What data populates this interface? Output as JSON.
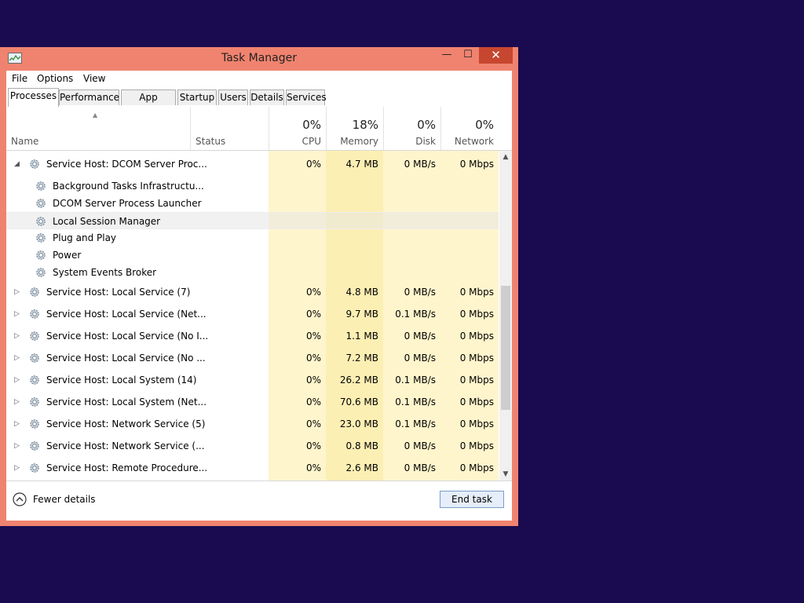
{
  "window": {
    "title": "Task Manager"
  },
  "titlebar": {
    "minimize": "—",
    "maximize": "☐",
    "close": "✕"
  },
  "menu": [
    "File",
    "Options",
    "View"
  ],
  "tabs": [
    "Processes",
    "Performance",
    "App history",
    "Startup",
    "Users",
    "Details",
    "Services"
  ],
  "active_tab": "Processes",
  "header": {
    "name": "Name",
    "status": "Status",
    "cpu": {
      "pct": "0%",
      "label": "CPU"
    },
    "memory": {
      "pct": "18%",
      "label": "Memory"
    },
    "disk": {
      "pct": "0%",
      "label": "Disk"
    },
    "network": {
      "pct": "0%",
      "label": "Network"
    }
  },
  "rows": [
    {
      "name": "Service Host: DCOM Server Proc...",
      "expander": "◢",
      "level": 0,
      "cpu": "0%",
      "memory": "4.7 MB",
      "disk": "0 MB/s",
      "network": "0 Mbps"
    },
    {
      "name": "Background Tasks Infrastructu...",
      "level": 1
    },
    {
      "name": "DCOM Server Process Launcher",
      "level": 1
    },
    {
      "name": "Local Session Manager",
      "level": 1,
      "highlight": true
    },
    {
      "name": "Plug and Play",
      "level": 1
    },
    {
      "name": "Power",
      "level": 1
    },
    {
      "name": "System Events Broker",
      "level": 1
    },
    {
      "name": "Service Host: Local Service (7)",
      "expander": "▷",
      "level": 0,
      "cpu": "0%",
      "memory": "4.8 MB",
      "disk": "0 MB/s",
      "network": "0 Mbps"
    },
    {
      "name": "Service Host: Local Service (Net...",
      "expander": "▷",
      "level": 0,
      "cpu": "0%",
      "memory": "9.7 MB",
      "disk": "0.1 MB/s",
      "network": "0 Mbps"
    },
    {
      "name": "Service Host: Local Service (No I...",
      "expander": "▷",
      "level": 0,
      "cpu": "0%",
      "memory": "1.1 MB",
      "disk": "0 MB/s",
      "network": "0 Mbps"
    },
    {
      "name": "Service Host: Local Service (No ...",
      "expander": "▷",
      "level": 0,
      "cpu": "0%",
      "memory": "7.2 MB",
      "disk": "0 MB/s",
      "network": "0 Mbps"
    },
    {
      "name": "Service Host: Local System (14)",
      "expander": "▷",
      "level": 0,
      "cpu": "0%",
      "memory": "26.2 MB",
      "disk": "0.1 MB/s",
      "network": "0 Mbps"
    },
    {
      "name": "Service Host: Local System (Net...",
      "expander": "▷",
      "level": 0,
      "cpu": "0%",
      "memory": "70.6 MB",
      "disk": "0.1 MB/s",
      "network": "0 Mbps"
    },
    {
      "name": "Service Host: Network Service (5)",
      "expander": "▷",
      "level": 0,
      "cpu": "0%",
      "memory": "23.0 MB",
      "disk": "0.1 MB/s",
      "network": "0 Mbps"
    },
    {
      "name": "Service Host: Network Service (...",
      "expander": "▷",
      "level": 0,
      "cpu": "0%",
      "memory": "0.8 MB",
      "disk": "0 MB/s",
      "network": "0 Mbps"
    },
    {
      "name": "Service Host: Remote Procedure...",
      "expander": "▷",
      "level": 0,
      "cpu": "0%",
      "memory": "2.6 MB",
      "disk": "0 MB/s",
      "network": "0 Mbps"
    }
  ],
  "footer": {
    "fewer_details": "Fewer details",
    "end_task": "End task"
  },
  "colors": {
    "frame": "#f0836f",
    "close": "#c7462f",
    "desktop": "#1a0a4f",
    "heat_light": "#fff5cc",
    "heat_medium": "#fcefb4"
  }
}
